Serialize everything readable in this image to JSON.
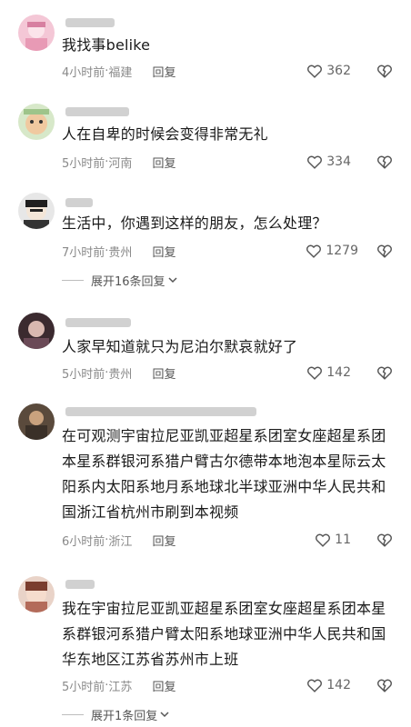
{
  "comments": [
    {
      "text": "我找事belike",
      "time": "4小时前",
      "location": "福建",
      "reply": "回复",
      "likes": "362"
    },
    {
      "text": "人在自卑的时候会变得非常无礼",
      "time": "5小时前",
      "location": "河南",
      "reply": "回复",
      "likes": "334"
    },
    {
      "text": "生活中，你遇到这样的朋友，怎么处理？",
      "time": "7小时前",
      "location": "贵州",
      "reply": "回复",
      "likes": "1279",
      "expand": "展开16条回复"
    },
    {
      "text": "人家早知道就只为尼泊尔默哀就好了",
      "time": "5小时前",
      "location": "贵州",
      "reply": "回复",
      "likes": "142"
    },
    {
      "text": "在可观测宇宙拉尼亚凯亚超星系团室女座超星系团本星系群银河系猎户臂古尔德带本地泡本星际云太阳系内太阳系地月系地球北半球亚洲中华人民共和国浙江省杭州市刷到本视频",
      "time": "6小时前",
      "location": "浙江",
      "reply": "回复",
      "likes": "11"
    },
    {
      "text": "我在宇宙拉尼亚凯亚超星系团室女座超星系团本星系群银河系猎户臂太阳系地球亚洲中华人民共和国华东地区江苏省苏州市上班",
      "time": "5小时前",
      "location": "江苏",
      "reply": "回复",
      "likes": "142",
      "expand": "展开1条回复"
    }
  ],
  "separator": " · "
}
